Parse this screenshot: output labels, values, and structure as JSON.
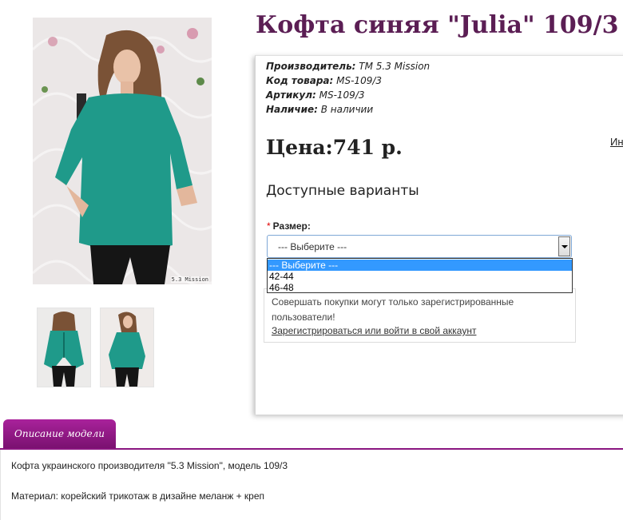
{
  "product": {
    "title": "Кофта синяя \"Julia\" 109/3",
    "photo_caption": "5.3 Mission",
    "meta": [
      {
        "label": "Производитель:",
        "value": " ТМ 5.3 Mission"
      },
      {
        "label": "Код товара:",
        "value": " MS-109/3"
      },
      {
        "label": "Артикул:",
        "value": " MS-109/3"
      },
      {
        "label": "Наличие:",
        "value": " В наличии"
      }
    ],
    "price_label": "Цена:",
    "price_value": "741 р.",
    "info_link": "Ин"
  },
  "options": {
    "heading": "Доступные варианты",
    "required_mark": "*",
    "size_label": "Размер:",
    "select_value": "--- Выберите ---",
    "dropdown_items": [
      "--- Выберите ---",
      "42-44",
      "46-48"
    ],
    "selected_index": 0
  },
  "notice": {
    "text": "Совершать покупки могут только зарегистрированные пользователи!",
    "link": "Зарегистрироваться или войти в свой аккаунт"
  },
  "description": {
    "tab_label": "Описание модели",
    "lines": [
      "Кофта украинского производителя \"5.3 Mission\", модель 109/3",
      "Материал: корейский трикотаж в дизайне меланж + креп"
    ]
  },
  "colors": {
    "title": "#5b1e54",
    "tab": "#8a1580",
    "garment": "#1f9a8a",
    "selected_option": "#3399ff"
  }
}
